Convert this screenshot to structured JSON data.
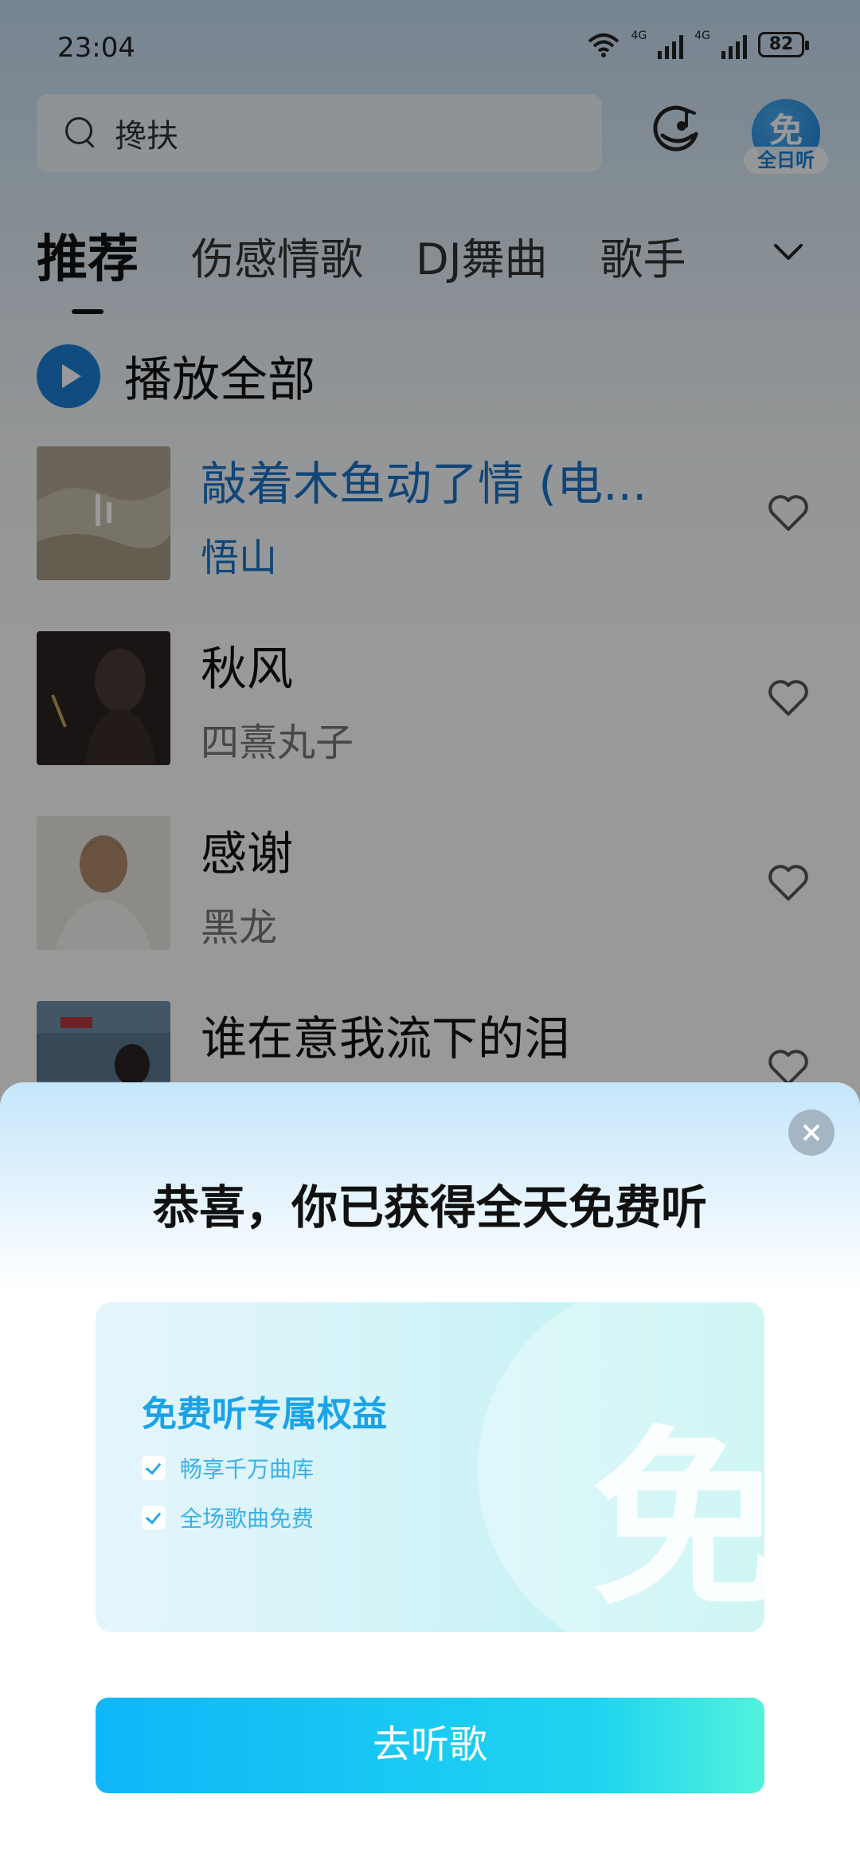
{
  "status_bar": {
    "time": "23:04",
    "network_1": "4G",
    "network_2": "4G",
    "battery": "82"
  },
  "search": {
    "query": "搀扶"
  },
  "header": {
    "free_avatar_glyph": "免",
    "free_avatar_badge": "全日听"
  },
  "tabs": [
    {
      "label": "推荐",
      "active": true
    },
    {
      "label": "伤感情歌",
      "active": false
    },
    {
      "label": "DJ舞曲",
      "active": false
    },
    {
      "label": "歌手",
      "active": false
    }
  ],
  "play_all": {
    "label": "播放全部"
  },
  "songs": [
    {
      "title": "敲着木鱼动了情 (电...",
      "artist": "悟山",
      "playing": true
    },
    {
      "title": "秋风",
      "artist": "四熹丸子",
      "playing": false
    },
    {
      "title": "感谢",
      "artist": "黑龙",
      "playing": false
    },
    {
      "title": "谁在意我流下的泪",
      "artist": "",
      "playing": false
    }
  ],
  "modal": {
    "title": "恭喜，你已获得全天免费听",
    "card": {
      "heading": "免费听专属权益",
      "watermark": "免",
      "benefits": [
        "畅享千万曲库",
        "全场歌曲免费"
      ]
    },
    "cta_label": "去听歌"
  },
  "colors": {
    "accent_blue": "#1c7fd6",
    "playing_text": "#1b74c8",
    "cta_start": "#10b6f8",
    "cta_end": "#52f2dc"
  }
}
